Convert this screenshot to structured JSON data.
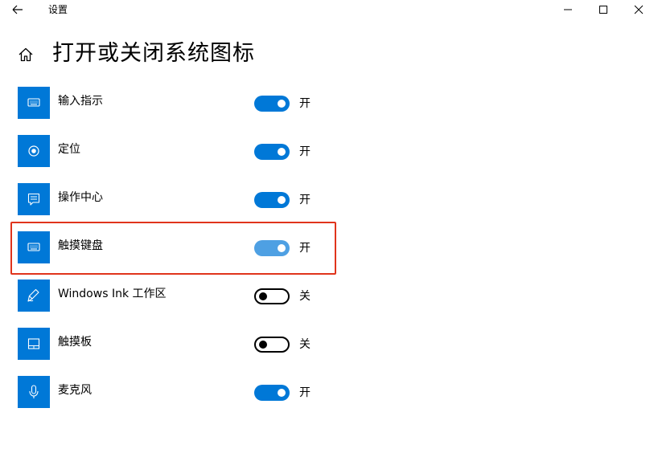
{
  "window": {
    "app_title": "设置"
  },
  "header": {
    "page_title": "打开或关闭系统图标"
  },
  "items": [
    {
      "label": "输入指示",
      "state": "开",
      "on": true,
      "icon": "keyboard-icon"
    },
    {
      "label": "定位",
      "state": "开",
      "on": true,
      "icon": "location-icon"
    },
    {
      "label": "操作中心",
      "state": "开",
      "on": true,
      "icon": "action-center-icon"
    },
    {
      "label": "触摸键盘",
      "state": "开",
      "on": true,
      "icon": "keyboard-icon",
      "highlighted": true
    },
    {
      "label": "Windows Ink 工作区",
      "state": "关",
      "on": false,
      "icon": "pen-icon"
    },
    {
      "label": "触摸板",
      "state": "关",
      "on": false,
      "icon": "touchpad-icon"
    },
    {
      "label": "麦克风",
      "state": "开",
      "on": true,
      "icon": "microphone-icon"
    }
  ],
  "colors": {
    "accent": "#0078d7",
    "highlight": "#e0341c"
  }
}
